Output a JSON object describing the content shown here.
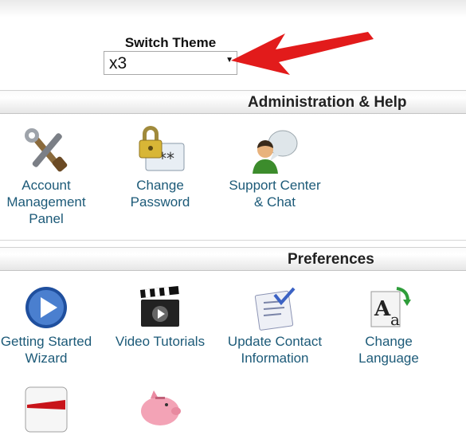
{
  "theme": {
    "title": "Switch Theme",
    "value": "x3"
  },
  "sections": {
    "admin": {
      "title": "Administration & Help",
      "items": [
        "Account\nManagement\nPanel",
        "Change\nPassword",
        "Support Center\n& Chat"
      ]
    },
    "prefs": {
      "title": "Preferences",
      "items": [
        "Getting Started\nWizard",
        "Video Tutorials",
        "Update Contact\nInformation",
        "Change\nLanguage"
      ]
    }
  },
  "colors": {
    "link": "#1c5a78",
    "arrow": "#e21b1b"
  },
  "icons": [
    "tools-icon",
    "padlock-password-icon",
    "support-chat-icon",
    "play-button-icon",
    "clapperboard-icon",
    "contact-card-icon",
    "language-letters-icon",
    "style-swatch-icon",
    "piggy-bank-icon"
  ]
}
